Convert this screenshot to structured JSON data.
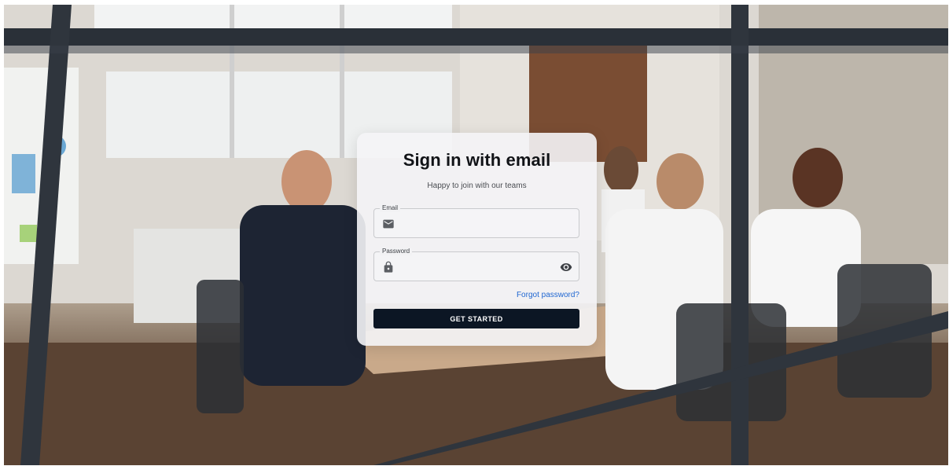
{
  "background": {
    "scene": "meeting-room-photo"
  },
  "card": {
    "title": "Sign in with email",
    "subtitle": "Happy to join with our teams",
    "email": {
      "label": "Email",
      "value": "",
      "icon": "mail-icon"
    },
    "password": {
      "label": "Password",
      "value": "",
      "icon": "lock-icon",
      "toggle_icon": "eye-icon"
    },
    "forgot_label": "Forgot password?",
    "submit_label": "GET STARTED"
  },
  "colors": {
    "button_bg": "#0c1624",
    "link": "#1f66d1",
    "card_bg": "#f4f4f6"
  }
}
